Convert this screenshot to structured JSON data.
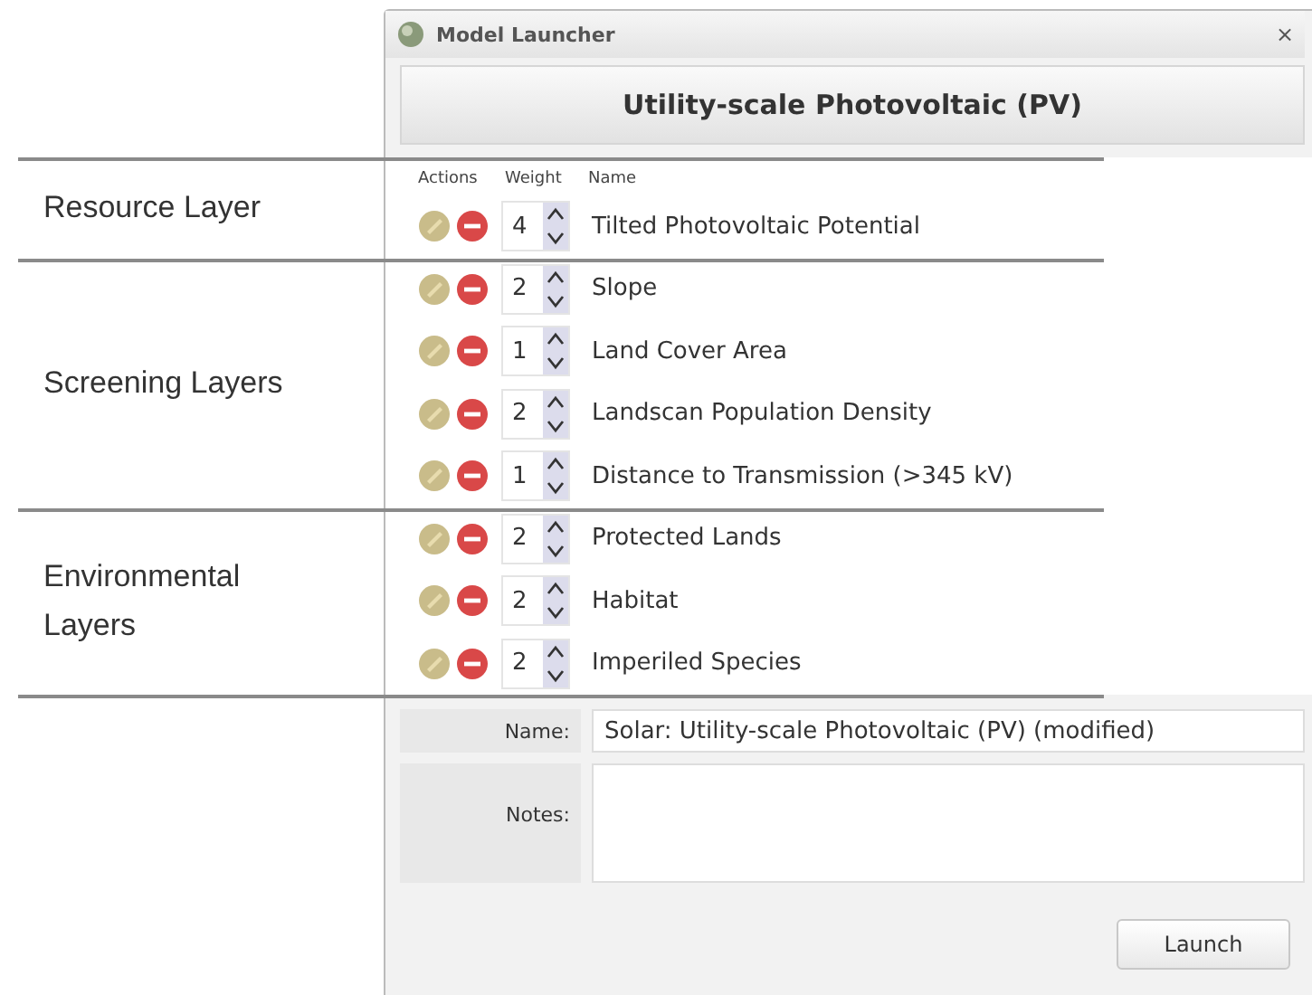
{
  "window": {
    "title": "Model Launcher",
    "close": "×"
  },
  "header": "Utility-scale Photovoltaic (PV)",
  "columns": [
    "Actions",
    "Weight",
    "Name"
  ],
  "groups": [
    {
      "label": "Resource Layer",
      "layers": [
        {
          "weight": "4",
          "name": "Tilted Photovoltaic Potential"
        }
      ]
    },
    {
      "label": "Screening Layers",
      "layers": [
        {
          "weight": "2",
          "name": "Slope"
        },
        {
          "weight": "1",
          "name": "Land Cover Area"
        },
        {
          "weight": "2",
          "name": "Landscan Population Density"
        },
        {
          "weight": "1",
          "name": "Distance to Transmission (>345 kV)"
        }
      ]
    },
    {
      "label": "Environmental Layers",
      "layers": [
        {
          "weight": "2",
          "name": "Protected Lands"
        },
        {
          "weight": "2",
          "name": "Habitat"
        },
        {
          "weight": "2",
          "name": "Imperiled Species"
        }
      ]
    }
  ],
  "form": {
    "name_label": "Name:",
    "name_value": "Solar: Utility-scale Photovoltaic (PV) (modified)",
    "notes_label": "Notes:"
  },
  "buttons": [
    "Launch"
  ]
}
